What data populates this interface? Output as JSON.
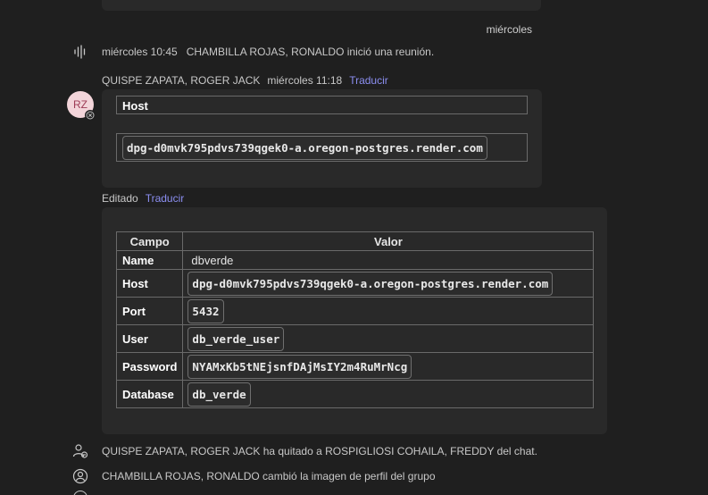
{
  "day_separator": "miércoles",
  "events": {
    "meeting": "miércoles 10:45   CHAMBILLA ROJAS, RONALDO inició una reunión.",
    "removed": "QUISPE ZAPATA, ROGER JACK ha quitado a ROSPIGLIOSI COHAILA, FREDDY del chat.",
    "picture": "CHAMBILLA ROJAS, RONALDO cambió la imagen de perfil del grupo"
  },
  "message": {
    "author": "QUISPE ZAPATA, ROGER JACK",
    "time": "miércoles 11:18",
    "translate": "Traducir",
    "avatar_initials": "RZ",
    "host_label": "Host",
    "host_value": "dpg-d0mvk795pdvs739qgek0-a.oregon-postgres.render.com"
  },
  "edited": {
    "label": "Editado",
    "translate": "Traducir"
  },
  "table": {
    "headers": [
      "Campo",
      "Valor"
    ],
    "rows": [
      {
        "key": "Name",
        "value": "dbverde",
        "code": false
      },
      {
        "key": "Host",
        "value": "dpg-d0mvk795pdvs739qgek0-a.oregon-postgres.render.com",
        "code": true
      },
      {
        "key": "Port",
        "value": "5432",
        "code": true
      },
      {
        "key": "User",
        "value": "db_verde_user",
        "code": true
      },
      {
        "key": "Password",
        "value": "NYAMxKb5tNEjsnfDAjMsIY2m4RuMrNcg",
        "code": true
      },
      {
        "key": "Database",
        "value": "db_verde",
        "code": true
      }
    ]
  },
  "icons": {
    "meeting": "waveform-icon",
    "removed": "person-remove-icon",
    "picture": "group-avatar-icon"
  }
}
